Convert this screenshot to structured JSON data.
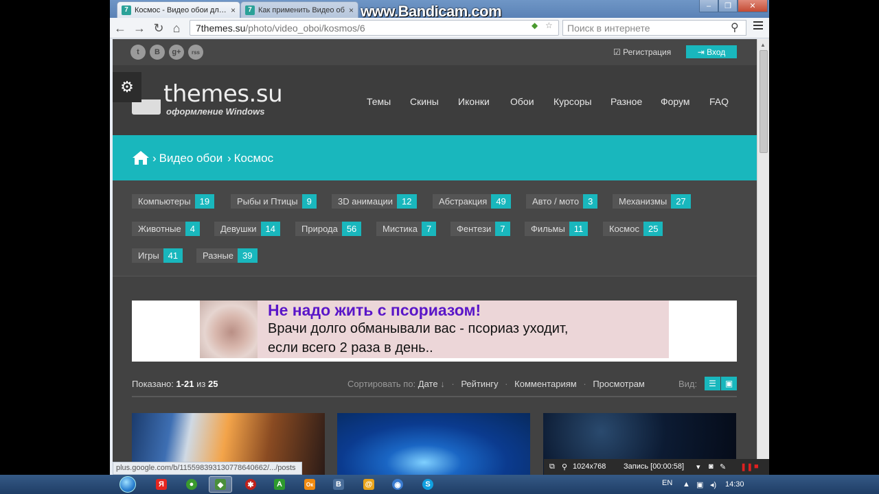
{
  "browser": {
    "tabs": [
      {
        "favicon": "7",
        "title": "Космос - Видео обои дл…"
      },
      {
        "favicon": "7",
        "title": "Как применить Видео об…"
      }
    ],
    "watermark": "www.Bandicam.com",
    "window_buttons": {
      "minimize": "–",
      "maximize": "❐",
      "close": "✕"
    },
    "url_host": "7themes.su",
    "url_path": "/photo/video_oboi/kosmos/6",
    "search_placeholder": "Поиск в интернете",
    "status_url": "plus.google.com/b/115598393130778640662/.../posts"
  },
  "site": {
    "social": [
      "t",
      "B",
      "g+",
      "rss"
    ],
    "register": "Регистрация",
    "login": "Вход",
    "logo_text": "themes.su",
    "logo_sub": "оформление Windows",
    "nav": [
      "Темы",
      "Скины",
      "Иконки",
      "Обои",
      "Курсоры",
      "Разное",
      "Форум",
      "FAQ"
    ],
    "breadcrumb": {
      "item1": "Видео обои",
      "item2": "Космос",
      "separator": "›"
    },
    "categories": [
      {
        "name": "Компьютеры",
        "count": "19"
      },
      {
        "name": "Рыбы и Птицы",
        "count": "9"
      },
      {
        "name": "3D анимации",
        "count": "12"
      },
      {
        "name": "Абстракция",
        "count": "49"
      },
      {
        "name": "Авто / мото",
        "count": "3"
      },
      {
        "name": "Механизмы",
        "count": "27"
      },
      {
        "name": "Животные",
        "count": "4"
      },
      {
        "name": "Девушки",
        "count": "14"
      },
      {
        "name": "Природа",
        "count": "56"
      },
      {
        "name": "Мистика",
        "count": "7"
      },
      {
        "name": "Фентези",
        "count": "7"
      },
      {
        "name": "Фильмы",
        "count": "11"
      },
      {
        "name": "Космос",
        "count": "25"
      },
      {
        "name": "Игры",
        "count": "41"
      },
      {
        "name": "Разные",
        "count": "39"
      }
    ],
    "ad": {
      "headline": "Не надо жить с псориазом!",
      "line1": "Врачи долго обманывали вас - псориаз уходит,",
      "line2": "если всего 2 раза в день.."
    },
    "shown": {
      "label": "Показано:",
      "range": "1-21",
      "of": "из",
      "total": "25"
    },
    "sort": {
      "label": "Сортировать по:",
      "date": "Дате",
      "arrow": "↓",
      "rating": "Рейтингу",
      "comments": "Комментариям",
      "views": "Просмотрам"
    },
    "view_label": "Вид:"
  },
  "bandicam": {
    "resolution": "1024x768",
    "record": "Запись [00:00:58]"
  },
  "taskbar": {
    "lang": "EN",
    "clock": "14:30",
    "apps": [
      {
        "icon": "yandex-icon",
        "glyph": "Я",
        "color": "#e52620"
      },
      {
        "icon": "chrome-icon",
        "glyph": "●",
        "color": "#3a9a2e"
      },
      {
        "icon": "browser-active-icon",
        "glyph": "◆",
        "color": "#4a8f3a"
      },
      {
        "icon": "opera-icon",
        "glyph": "✱",
        "color": "#c0211b"
      },
      {
        "icon": "green-app-icon",
        "glyph": "A",
        "color": "#2d9a2d"
      },
      {
        "icon": "odnoklassniki-icon",
        "glyph": "Ок",
        "color": "#f08a10"
      },
      {
        "icon": "vk-icon",
        "glyph": "В",
        "color": "#4a6e9a"
      },
      {
        "icon": "mail-agent-icon",
        "glyph": "@",
        "color": "#e8a31a"
      },
      {
        "icon": "firefox-icon",
        "glyph": "◉",
        "color": "#3a7bd0"
      },
      {
        "icon": "skype-icon",
        "glyph": "S",
        "color": "#10a0e0"
      }
    ]
  },
  "colors": {
    "accent": "#19b7bd",
    "page_bg": "#474747",
    "ad_headline": "#5a16c8"
  }
}
